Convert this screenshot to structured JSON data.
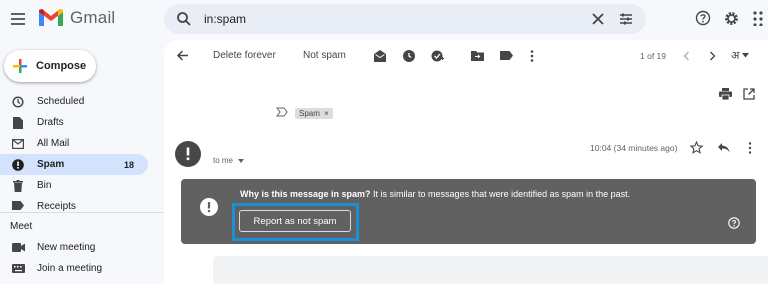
{
  "app": {
    "name": "Gmail"
  },
  "search": {
    "query": "in:spam"
  },
  "compose": {
    "label": "Compose"
  },
  "sidebar": {
    "items": [
      {
        "label": "Scheduled",
        "icon": "scheduled-icon"
      },
      {
        "label": "Drafts",
        "icon": "drafts-icon"
      },
      {
        "label": "All Mail",
        "icon": "all-mail-icon"
      },
      {
        "label": "Spam",
        "icon": "spam-icon",
        "count": "18",
        "active": true
      },
      {
        "label": "Bin",
        "icon": "bin-icon"
      },
      {
        "label": "Receipts",
        "icon": "label-icon"
      }
    ]
  },
  "meet": {
    "title": "Meet",
    "items": [
      {
        "label": "New meeting",
        "icon": "video-icon"
      },
      {
        "label": "Join a meeting",
        "icon": "keyboard-icon"
      }
    ]
  },
  "toolbar": {
    "delete_forever": "Delete forever",
    "not_spam": "Not spam",
    "page_counter": "1 of 19",
    "lang_glyph": "अ"
  },
  "message": {
    "tag": "Spam",
    "time": "10:04 (34 minutes ago)",
    "recipient": "to me"
  },
  "banner": {
    "question": "Why is this message in spam?",
    "explanation": " It is similar to messages that were identified as spam in the past.",
    "report_button": "Report as not spam"
  },
  "colors": {
    "banner_bg": "#616161",
    "highlight_border": "#1d8fd8",
    "active_nav_bg": "#d3e3fd"
  }
}
